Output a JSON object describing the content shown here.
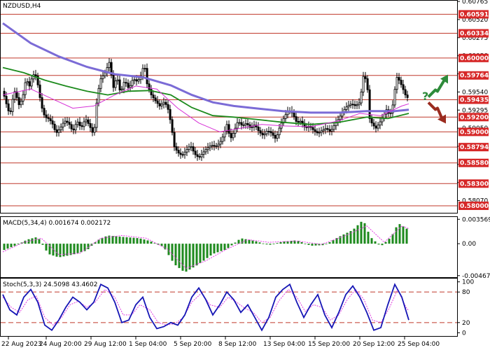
{
  "chart_data": {
    "type": "candlestick",
    "symbol_title": "NZDUSD,H4",
    "main": {
      "ylim": [
        0.57905,
        0.60775
      ],
      "price_ticks": [
        "0.60765",
        "0.60520",
        "0.60275",
        "0.60030",
        "0.59785",
        "0.59540",
        "0.59295",
        "0.59050",
        "0.58805",
        "0.58560",
        "0.58315",
        "0.58070"
      ],
      "levels": [
        {
          "label": "0.60591",
          "value": 0.60591
        },
        {
          "label": "0.60334",
          "value": 0.60334
        },
        {
          "label": "0.60000",
          "value": 0.6
        },
        {
          "label": "0.59764",
          "value": 0.59764
        },
        {
          "label": "0.59435",
          "value": 0.59435
        },
        {
          "label": "0.59200",
          "value": 0.592
        },
        {
          "label": "0.59000",
          "value": 0.59
        },
        {
          "label": "0.58794",
          "value": 0.58794
        },
        {
          "label": "0.58580",
          "value": 0.5858
        },
        {
          "label": "0.58300",
          "value": 0.583
        },
        {
          "label": "0.58000",
          "value": 0.58
        }
      ],
      "close_path": [
        [
          0,
          0.5955
        ],
        [
          5,
          0.5938
        ],
        [
          10,
          0.5922
        ],
        [
          14,
          0.5944
        ],
        [
          18,
          0.5958
        ],
        [
          22,
          0.5935
        ],
        [
          28,
          0.5945
        ],
        [
          33,
          0.5972
        ],
        [
          38,
          0.5962
        ],
        [
          43,
          0.5978
        ],
        [
          48,
          0.5975
        ],
        [
          55,
          0.5935
        ],
        [
          60,
          0.592
        ],
        [
          65,
          0.5918
        ],
        [
          70,
          0.5913
        ],
        [
          76,
          0.5898
        ],
        [
          82,
          0.5905
        ],
        [
          88,
          0.5915
        ],
        [
          94,
          0.5912
        ],
        [
          100,
          0.59
        ],
        [
          106,
          0.5915
        ],
        [
          112,
          0.5905
        ],
        [
          118,
          0.5918
        ],
        [
          124,
          0.5908
        ],
        [
          130,
          0.5895
        ],
        [
          135,
          0.595
        ],
        [
          140,
          0.5972
        ],
        [
          146,
          0.598
        ],
        [
          152,
          0.5994
        ],
        [
          158,
          0.596
        ],
        [
          163,
          0.5975
        ],
        [
          168,
          0.5952
        ],
        [
          174,
          0.597
        ],
        [
          180,
          0.5958
        ],
        [
          186,
          0.5972
        ],
        [
          192,
          0.5968
        ],
        [
          197,
          0.5975
        ],
        [
          202,
          0.5993
        ],
        [
          206,
          0.5965
        ],
        [
          212,
          0.595
        ],
        [
          218,
          0.5942
        ],
        [
          224,
          0.5935
        ],
        [
          230,
          0.594
        ],
        [
          235,
          0.5935
        ],
        [
          240,
          0.5912
        ],
        [
          245,
          0.588
        ],
        [
          250,
          0.5872
        ],
        [
          256,
          0.5868
        ],
        [
          262,
          0.5875
        ],
        [
          268,
          0.5882
        ],
        [
          274,
          0.587
        ],
        [
          280,
          0.5865
        ],
        [
          286,
          0.5872
        ],
        [
          292,
          0.5878
        ],
        [
          298,
          0.5882
        ],
        [
          304,
          0.588
        ],
        [
          310,
          0.5885
        ],
        [
          315,
          0.5895
        ],
        [
          320,
          0.591
        ],
        [
          325,
          0.589
        ],
        [
          330,
          0.59
        ],
        [
          336,
          0.5915
        ],
        [
          342,
          0.5908
        ],
        [
          348,
          0.5912
        ],
        [
          354,
          0.5905
        ],
        [
          360,
          0.591
        ],
        [
          366,
          0.59
        ],
        [
          372,
          0.5895
        ],
        [
          378,
          0.5902
        ],
        [
          384,
          0.5898
        ],
        [
          390,
          0.589
        ],
        [
          396,
          0.5908
        ],
        [
          402,
          0.592
        ],
        [
          408,
          0.593
        ],
        [
          414,
          0.5925
        ],
        [
          420,
          0.5912
        ],
        [
          426,
          0.5915
        ],
        [
          432,
          0.5905
        ],
        [
          438,
          0.5908
        ],
        [
          444,
          0.5902
        ],
        [
          450,
          0.5898
        ],
        [
          456,
          0.5902
        ],
        [
          462,
          0.5905
        ],
        [
          468,
          0.59
        ],
        [
          474,
          0.591
        ],
        [
          480,
          0.5918
        ],
        [
          486,
          0.5928
        ],
        [
          492,
          0.5935
        ],
        [
          498,
          0.5938
        ],
        [
          504,
          0.5935
        ],
        [
          510,
          0.594
        ],
        [
          515,
          0.5975
        ],
        [
          520,
          0.597
        ],
        [
          524,
          0.5918
        ],
        [
          528,
          0.591
        ],
        [
          533,
          0.5905
        ],
        [
          538,
          0.5912
        ],
        [
          543,
          0.592
        ],
        [
          548,
          0.593
        ],
        [
          553,
          0.5922
        ],
        [
          558,
          0.594
        ],
        [
          562,
          0.5975
        ],
        [
          566,
          0.597
        ],
        [
          570,
          0.5962
        ],
        [
          575,
          0.595
        ],
        [
          580,
          0.5944
        ]
      ],
      "ma_slow": [
        [
          0,
          0.6047
        ],
        [
          40,
          0.602
        ],
        [
          80,
          0.6002
        ],
        [
          120,
          0.5988
        ],
        [
          160,
          0.5978
        ],
        [
          200,
          0.5974
        ],
        [
          240,
          0.5963
        ],
        [
          270,
          0.595
        ],
        [
          300,
          0.594
        ],
        [
          330,
          0.5935
        ],
        [
          360,
          0.5932
        ],
        [
          400,
          0.5928
        ],
        [
          440,
          0.5926
        ],
        [
          480,
          0.5926
        ],
        [
          520,
          0.5928
        ],
        [
          560,
          0.5928
        ],
        [
          580,
          0.593
        ]
      ],
      "ma_mid": [
        [
          0,
          0.5987
        ],
        [
          30,
          0.598
        ],
        [
          60,
          0.597
        ],
        [
          90,
          0.5962
        ],
        [
          120,
          0.5955
        ],
        [
          150,
          0.595
        ],
        [
          180,
          0.5955
        ],
        [
          210,
          0.5956
        ],
        [
          240,
          0.595
        ],
        [
          270,
          0.5933
        ],
        [
          300,
          0.5922
        ],
        [
          330,
          0.592
        ],
        [
          360,
          0.5917
        ],
        [
          400,
          0.5913
        ],
        [
          440,
          0.591
        ],
        [
          480,
          0.5913
        ],
        [
          520,
          0.592
        ],
        [
          550,
          0.5918
        ],
        [
          580,
          0.5925
        ]
      ],
      "ma_fast": [
        [
          0,
          0.595
        ],
        [
          40,
          0.5958
        ],
        [
          70,
          0.5945
        ],
        [
          100,
          0.5932
        ],
        [
          130,
          0.5935
        ],
        [
          160,
          0.595
        ],
        [
          190,
          0.5962
        ],
        [
          220,
          0.5958
        ],
        [
          250,
          0.5932
        ],
        [
          280,
          0.5912
        ],
        [
          310,
          0.59
        ],
        [
          340,
          0.5905
        ],
        [
          370,
          0.591
        ],
        [
          400,
          0.5908
        ],
        [
          440,
          0.5907
        ],
        [
          480,
          0.5915
        ],
        [
          510,
          0.5925
        ],
        [
          540,
          0.5922
        ],
        [
          570,
          0.5935
        ],
        [
          580,
          0.5938
        ]
      ],
      "ma_colors": {
        "slow": "#7b6bd6",
        "mid": "#1c8a1c",
        "fast": "#d62fd6"
      }
    },
    "macd": {
      "title": "MACD(5,34,4) 0.001674 0.002172",
      "ylim": [
        -0.0049,
        0.0038
      ],
      "ticks": [
        {
          "label": "0.003569",
          "value": 0.003569
        },
        {
          "label": "0.00",
          "value": 0.0
        },
        {
          "label": "-0.004672",
          "value": -0.004672
        }
      ],
      "histogram": [
        [
          0,
          -0.001
        ],
        [
          20,
          -0.0002
        ],
        [
          35,
          0.0006
        ],
        [
          50,
          0.001
        ],
        [
          65,
          -0.0015
        ],
        [
          80,
          -0.002
        ],
        [
          100,
          -0.0016
        ],
        [
          120,
          -0.001
        ],
        [
          135,
          0.0005
        ],
        [
          150,
          0.0012
        ],
        [
          170,
          0.001
        ],
        [
          195,
          0.0008
        ],
        [
          210,
          0.0004
        ],
        [
          230,
          -0.0005
        ],
        [
          245,
          -0.003
        ],
        [
          260,
          -0.0042
        ],
        [
          280,
          -0.003
        ],
        [
          300,
          -0.0015
        ],
        [
          320,
          -0.0008
        ],
        [
          340,
          0.0008
        ],
        [
          360,
          0.0004
        ],
        [
          380,
          -0.0002
        ],
        [
          400,
          0.0003
        ],
        [
          420,
          0.0005
        ],
        [
          440,
          -0.0003
        ],
        [
          460,
          -0.0002
        ],
        [
          480,
          0.001
        ],
        [
          500,
          0.002
        ],
        [
          515,
          0.0035
        ],
        [
          525,
          0.001
        ],
        [
          540,
          -0.0004
        ],
        [
          555,
          0.001
        ],
        [
          565,
          0.003
        ],
        [
          580,
          0.002
        ]
      ],
      "signal": [
        [
          0,
          -0.0012
        ],
        [
          30,
          0.0002
        ],
        [
          55,
          0.0008
        ],
        [
          80,
          -0.0016
        ],
        [
          110,
          -0.0014
        ],
        [
          140,
          0.0008
        ],
        [
          170,
          0.0012
        ],
        [
          205,
          0.0008
        ],
        [
          235,
          -0.0008
        ],
        [
          262,
          -0.0036
        ],
        [
          290,
          -0.0025
        ],
        [
          320,
          -0.0008
        ],
        [
          350,
          0.0006
        ],
        [
          380,
          0.0002
        ],
        [
          420,
          0.0004
        ],
        [
          455,
          -0.0001
        ],
        [
          490,
          0.0012
        ],
        [
          520,
          0.0026
        ],
        [
          545,
          0.0002
        ],
        [
          570,
          0.0026
        ],
        [
          580,
          0.0022
        ]
      ],
      "colors": {
        "histogram": "#1d8a1d",
        "signal": "#e63ae6"
      }
    },
    "stoch": {
      "title": "Stoch(5,3,3) 24.5098 43.4602",
      "ylim": [
        -5,
        105
      ],
      "ticks": [
        {
          "label": "100",
          "value": 100
        },
        {
          "label": "80",
          "value": 80
        },
        {
          "label": "20",
          "value": 20
        },
        {
          "label": "0",
          "value": 0
        }
      ],
      "levels": [
        80,
        20
      ],
      "main": [
        [
          0,
          75
        ],
        [
          10,
          45
        ],
        [
          20,
          35
        ],
        [
          30,
          70
        ],
        [
          40,
          85
        ],
        [
          50,
          60
        ],
        [
          60,
          15
        ],
        [
          70,
          5
        ],
        [
          80,
          25
        ],
        [
          90,
          50
        ],
        [
          100,
          70
        ],
        [
          110,
          60
        ],
        [
          120,
          45
        ],
        [
          130,
          60
        ],
        [
          140,
          95
        ],
        [
          150,
          88
        ],
        [
          160,
          60
        ],
        [
          170,
          20
        ],
        [
          180,
          25
        ],
        [
          190,
          55
        ],
        [
          200,
          70
        ],
        [
          210,
          30
        ],
        [
          220,
          8
        ],
        [
          230,
          12
        ],
        [
          240,
          20
        ],
        [
          250,
          15
        ],
        [
          260,
          35
        ],
        [
          270,
          70
        ],
        [
          280,
          88
        ],
        [
          290,
          65
        ],
        [
          300,
          35
        ],
        [
          310,
          55
        ],
        [
          320,
          80
        ],
        [
          330,
          65
        ],
        [
          340,
          40
        ],
        [
          350,
          55
        ],
        [
          360,
          30
        ],
        [
          370,
          5
        ],
        [
          380,
          30
        ],
        [
          390,
          70
        ],
        [
          400,
          85
        ],
        [
          410,
          95
        ],
        [
          420,
          60
        ],
        [
          430,
          30
        ],
        [
          440,
          55
        ],
        [
          450,
          75
        ],
        [
          460,
          35
        ],
        [
          470,
          10
        ],
        [
          480,
          40
        ],
        [
          490,
          75
        ],
        [
          500,
          92
        ],
        [
          510,
          70
        ],
        [
          520,
          40
        ],
        [
          530,
          5
        ],
        [
          540,
          10
        ],
        [
          550,
          55
        ],
        [
          560,
          95
        ],
        [
          570,
          70
        ],
        [
          580,
          25
        ]
      ],
      "signal": [
        [
          0,
          70
        ],
        [
          12,
          50
        ],
        [
          24,
          40
        ],
        [
          36,
          65
        ],
        [
          48,
          72
        ],
        [
          60,
          30
        ],
        [
          72,
          15
        ],
        [
          84,
          30
        ],
        [
          96,
          55
        ],
        [
          108,
          62
        ],
        [
          120,
          50
        ],
        [
          132,
          60
        ],
        [
          146,
          85
        ],
        [
          160,
          70
        ],
        [
          172,
          35
        ],
        [
          184,
          35
        ],
        [
          196,
          55
        ],
        [
          210,
          45
        ],
        [
          222,
          20
        ],
        [
          234,
          15
        ],
        [
          246,
          18
        ],
        [
          258,
          30
        ],
        [
          270,
          60
        ],
        [
          284,
          78
        ],
        [
          296,
          55
        ],
        [
          310,
          50
        ],
        [
          322,
          70
        ],
        [
          334,
          60
        ],
        [
          346,
          48
        ],
        [
          358,
          40
        ],
        [
          370,
          20
        ],
        [
          382,
          30
        ],
        [
          394,
          62
        ],
        [
          408,
          85
        ],
        [
          420,
          70
        ],
        [
          432,
          42
        ],
        [
          444,
          55
        ],
        [
          456,
          50
        ],
        [
          468,
          25
        ],
        [
          480,
          35
        ],
        [
          492,
          65
        ],
        [
          504,
          85
        ],
        [
          516,
          65
        ],
        [
          528,
          25
        ],
        [
          540,
          20
        ],
        [
          552,
          48
        ],
        [
          564,
          85
        ],
        [
          576,
          50
        ],
        [
          580,
          43
        ]
      ],
      "colors": {
        "main": "#1515b5",
        "signal": "#e03ae0"
      }
    },
    "x_labels": [
      "22 Aug 2023",
      "24 Aug 20:00",
      "29 Aug 12:00",
      "1 Sep 04:00",
      "5 Sep 20:00",
      "8 Sep 12:00",
      "13 Sep 04:00",
      "15 Sep 20:00",
      "20 Sep 12:00",
      "25 Sep 04:00"
    ],
    "annotation": {
      "question_mark": "?",
      "up_color": "#2e8b3a",
      "down_color": "#9b2b1f"
    }
  }
}
